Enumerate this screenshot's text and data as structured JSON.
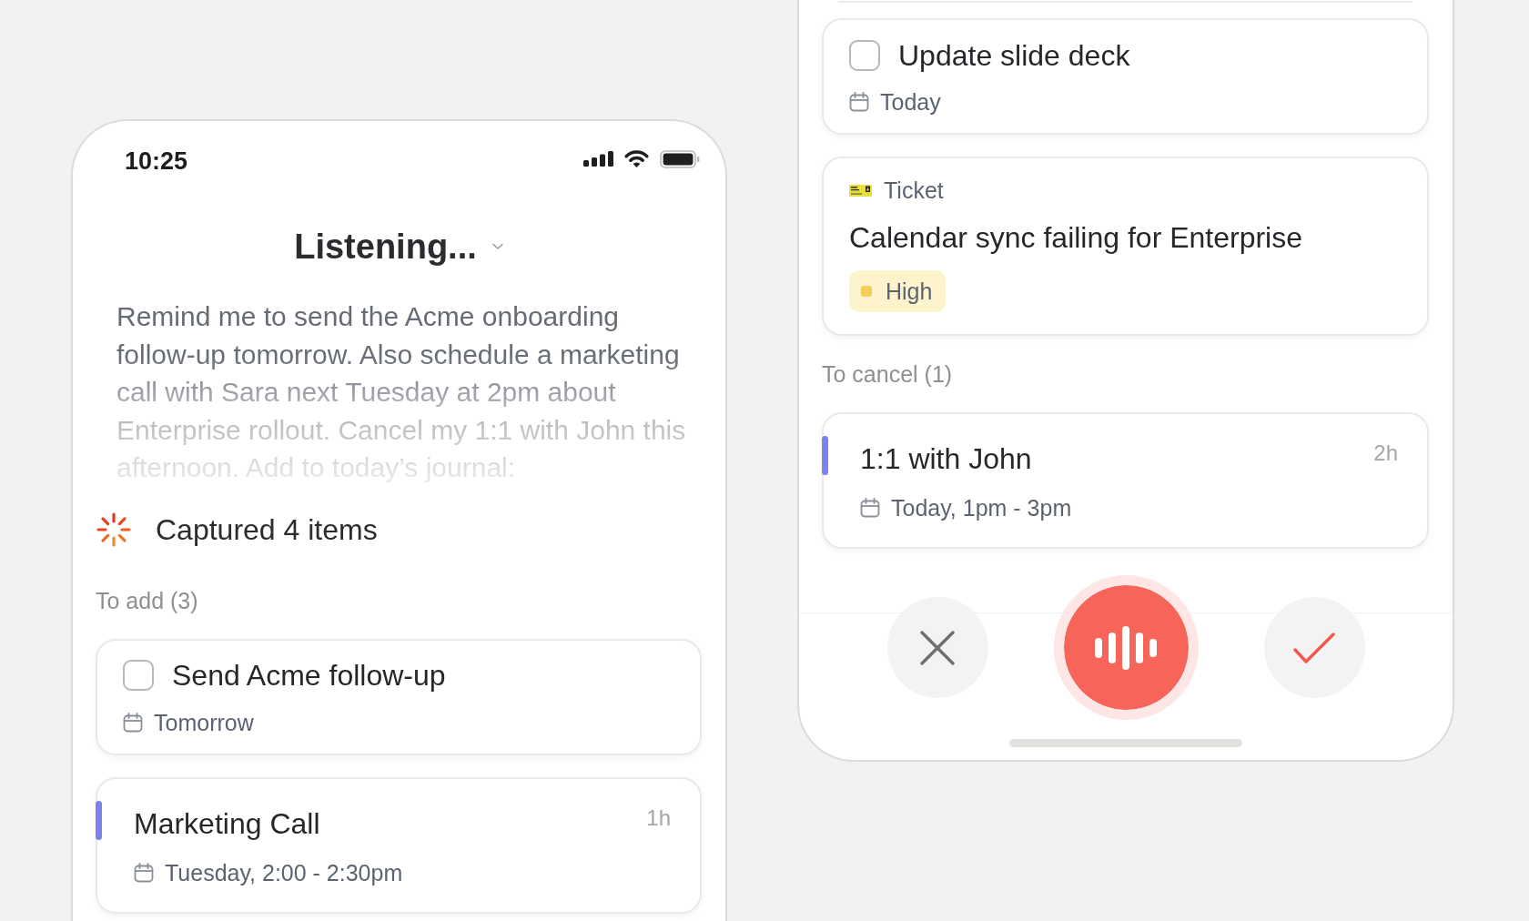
{
  "phones": [
    {
      "kind": "top",
      "status_bar": {
        "time": "10:25"
      },
      "header": {
        "title": "Listening..."
      },
      "transcript": "Remind me to send the Acme onboarding follow-up tomorrow. Also schedule a marketing call with Sara next Tuesday at 2pm about Enterprise rollout. Cancel my 1:1 with John this afternoon. Add to today’s journal:",
      "summary": "Captured 4 items",
      "sections": [
        {
          "label": "To add (3)",
          "items": [
            {
              "kind": "task",
              "title": "Send Acme follow-up",
              "checked": false,
              "date": "Tomorrow"
            },
            {
              "kind": "event",
              "title": "Marketing Call",
              "duration": "1h",
              "date": "Tuesday, 2:00 - 2:30pm",
              "color": "#7b83eb"
            }
          ]
        }
      ]
    },
    {
      "kind": "bottom",
      "sections": [
        {
          "items": [
            {
              "kind": "task",
              "title": "Update slide deck",
              "checked": false,
              "date": "Today"
            },
            {
              "kind": "ticket",
              "type": "Ticket",
              "title": "Calendar sync failing for Enterprise",
              "priority": {
                "label": "High",
                "color": "#f2cf58"
              }
            }
          ]
        },
        {
          "label": "To cancel (1)",
          "items": [
            {
              "kind": "event",
              "title": "1:1 with John",
              "duration": "2h",
              "date": "Today, 1pm - 3pm",
              "color": "#7b83eb"
            }
          ]
        }
      ]
    }
  ]
}
